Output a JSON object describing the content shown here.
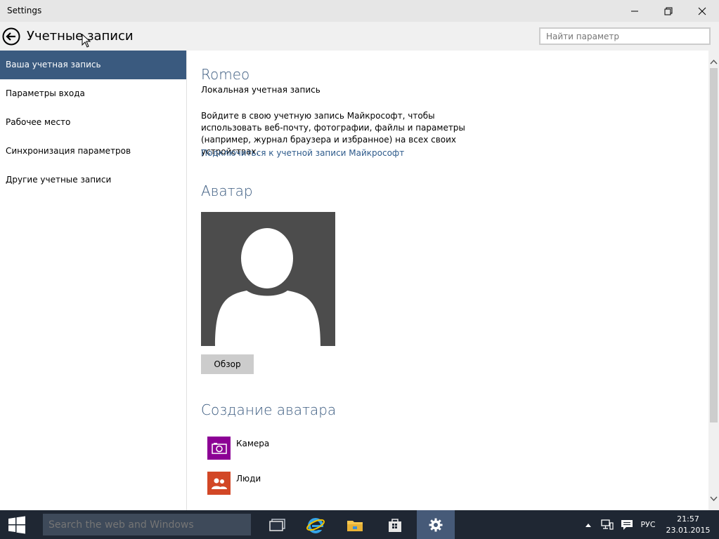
{
  "window": {
    "title": "Settings"
  },
  "header": {
    "title": "Учетные записи",
    "search_placeholder": "Найти параметр"
  },
  "sidebar": {
    "items": [
      {
        "label": "Ваша учетная запись"
      },
      {
        "label": "Параметры входа"
      },
      {
        "label": "Рабочее место"
      },
      {
        "label": "Синхронизация параметров"
      },
      {
        "label": "Другие учетные записи"
      }
    ]
  },
  "main": {
    "user_name": "Romeo",
    "account_type": "Локальная учетная запись",
    "description": "Войдите в свою учетную запись Майкрософт, чтобы использовать веб-почту, фотографии, файлы и параметры (например, журнал браузера и избранное) на всех своих устройствах.",
    "connect_link": "Подключиться к учетной записи Майкрософт",
    "avatar_heading": "Аватар",
    "browse_label": "Обзор",
    "create_heading": "Создание аватара",
    "apps": [
      {
        "label": "Камера",
        "color": "#8c0095",
        "icon": "camera-icon"
      },
      {
        "label": "Люди",
        "color": "#d24726",
        "icon": "people-icon"
      }
    ]
  },
  "taskbar": {
    "search_placeholder": "Search the web and Windows",
    "language": "РУС",
    "time": "21:57",
    "date": "23.01.2015"
  },
  "colors": {
    "accent": "#3a5a7f",
    "taskbar": "#1f2733"
  }
}
